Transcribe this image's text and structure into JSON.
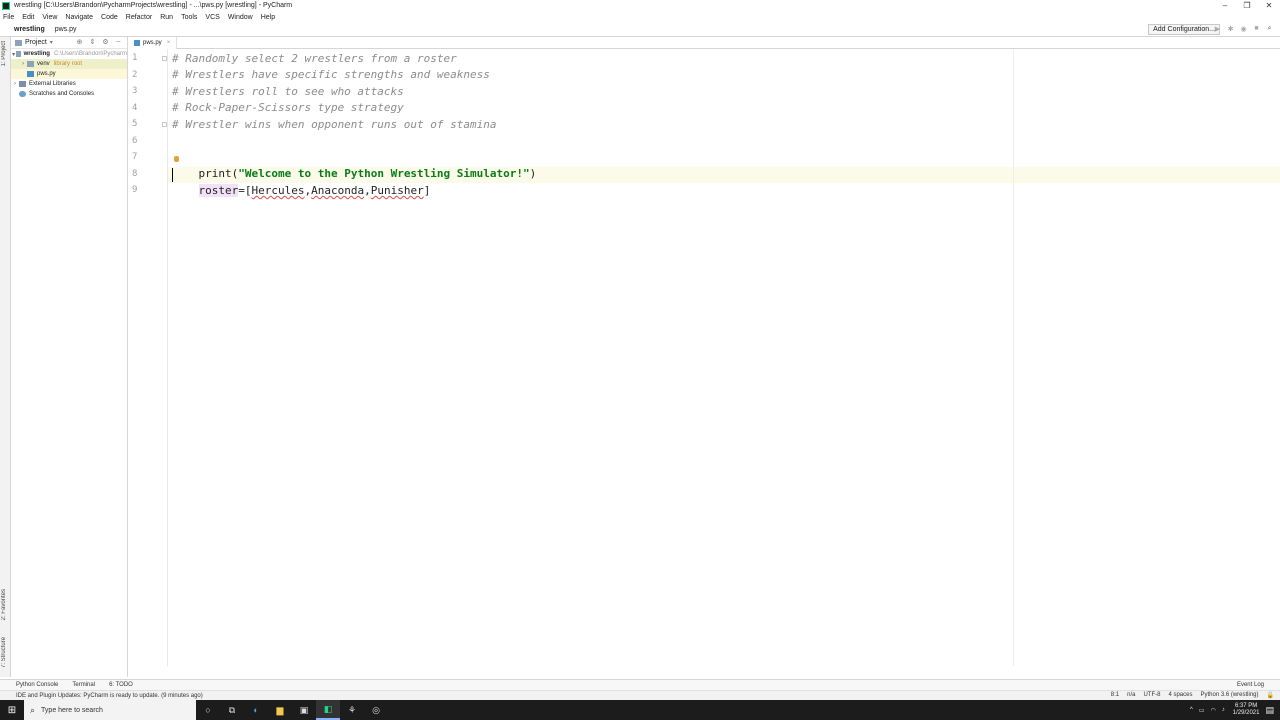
{
  "window": {
    "title": "wrestling [C:\\Users\\Brandon\\PycharmProjects\\wrestling] - ...\\pws.py [wrestling] - PyCharm",
    "controls": [
      "–",
      "❐",
      "✕"
    ]
  },
  "menu": [
    "File",
    "Edit",
    "View",
    "Navigate",
    "Code",
    "Refactor",
    "Run",
    "Tools",
    "VCS",
    "Window",
    "Help"
  ],
  "nav": {
    "breadcrumbs": [
      "wrestling",
      "pws.py"
    ],
    "add_config": "Add Configuration..."
  },
  "left_strip": {
    "project": "1: Project",
    "favorites": "2: Favorites",
    "structure": "7: Structure"
  },
  "project_panel": {
    "header": "Project",
    "tree": [
      {
        "label": "wrestling",
        "hint": "C:\\Users\\Brandon\\Pycharm"
      },
      {
        "label": "venv",
        "hint": "library root"
      },
      {
        "label": "pws.py",
        "hint": ""
      },
      {
        "label": "External Libraries",
        "hint": ""
      },
      {
        "label": "Scratches and Consoles",
        "hint": ""
      }
    ]
  },
  "editor": {
    "tab": "pws.py",
    "line_numbers": [
      "1",
      "2",
      "3",
      "4",
      "5",
      "6",
      "7",
      "8",
      "9"
    ],
    "lines": {
      "l1": "# Randomly select 2 wrestlers from a roster",
      "l2": "# Wrestlers have specific strengths and weakness",
      "l3": "# Wrestlers roll to see who attacks",
      "l4": "# Rock-Paper-Scissors type strategy",
      "l5": "# Wrestler wins when opponent runs out of stamina",
      "l7_fn": "print(",
      "l7_str": "\"Welcome to the Python Wrestling Simulator!\"",
      "l7_end": ")",
      "l8_var": "roster",
      "l8_eq": "=[",
      "l8_a": "Hercules",
      "l8_c1": ",",
      "l8_b": "Anaconda",
      "l8_c2": ",",
      "l8_c": "Punisher",
      "l8_end": "]"
    }
  },
  "bottom_tools": {
    "python_console": "Python Console",
    "terminal": "Terminal",
    "todo": "6: TODO",
    "event_log": "Event Log"
  },
  "status": {
    "message": "IDE and Plugin Updates: PyCharm is ready to update. (9 minutes ago)",
    "position": "8:1",
    "na": "n/a",
    "encoding": "UTF-8",
    "indent": "4 spaces",
    "interpreter": "Python 3.6 (wrestling)"
  },
  "taskbar": {
    "search_placeholder": "Type here to search",
    "time": "6:37 PM",
    "date": "1/29/2021"
  }
}
